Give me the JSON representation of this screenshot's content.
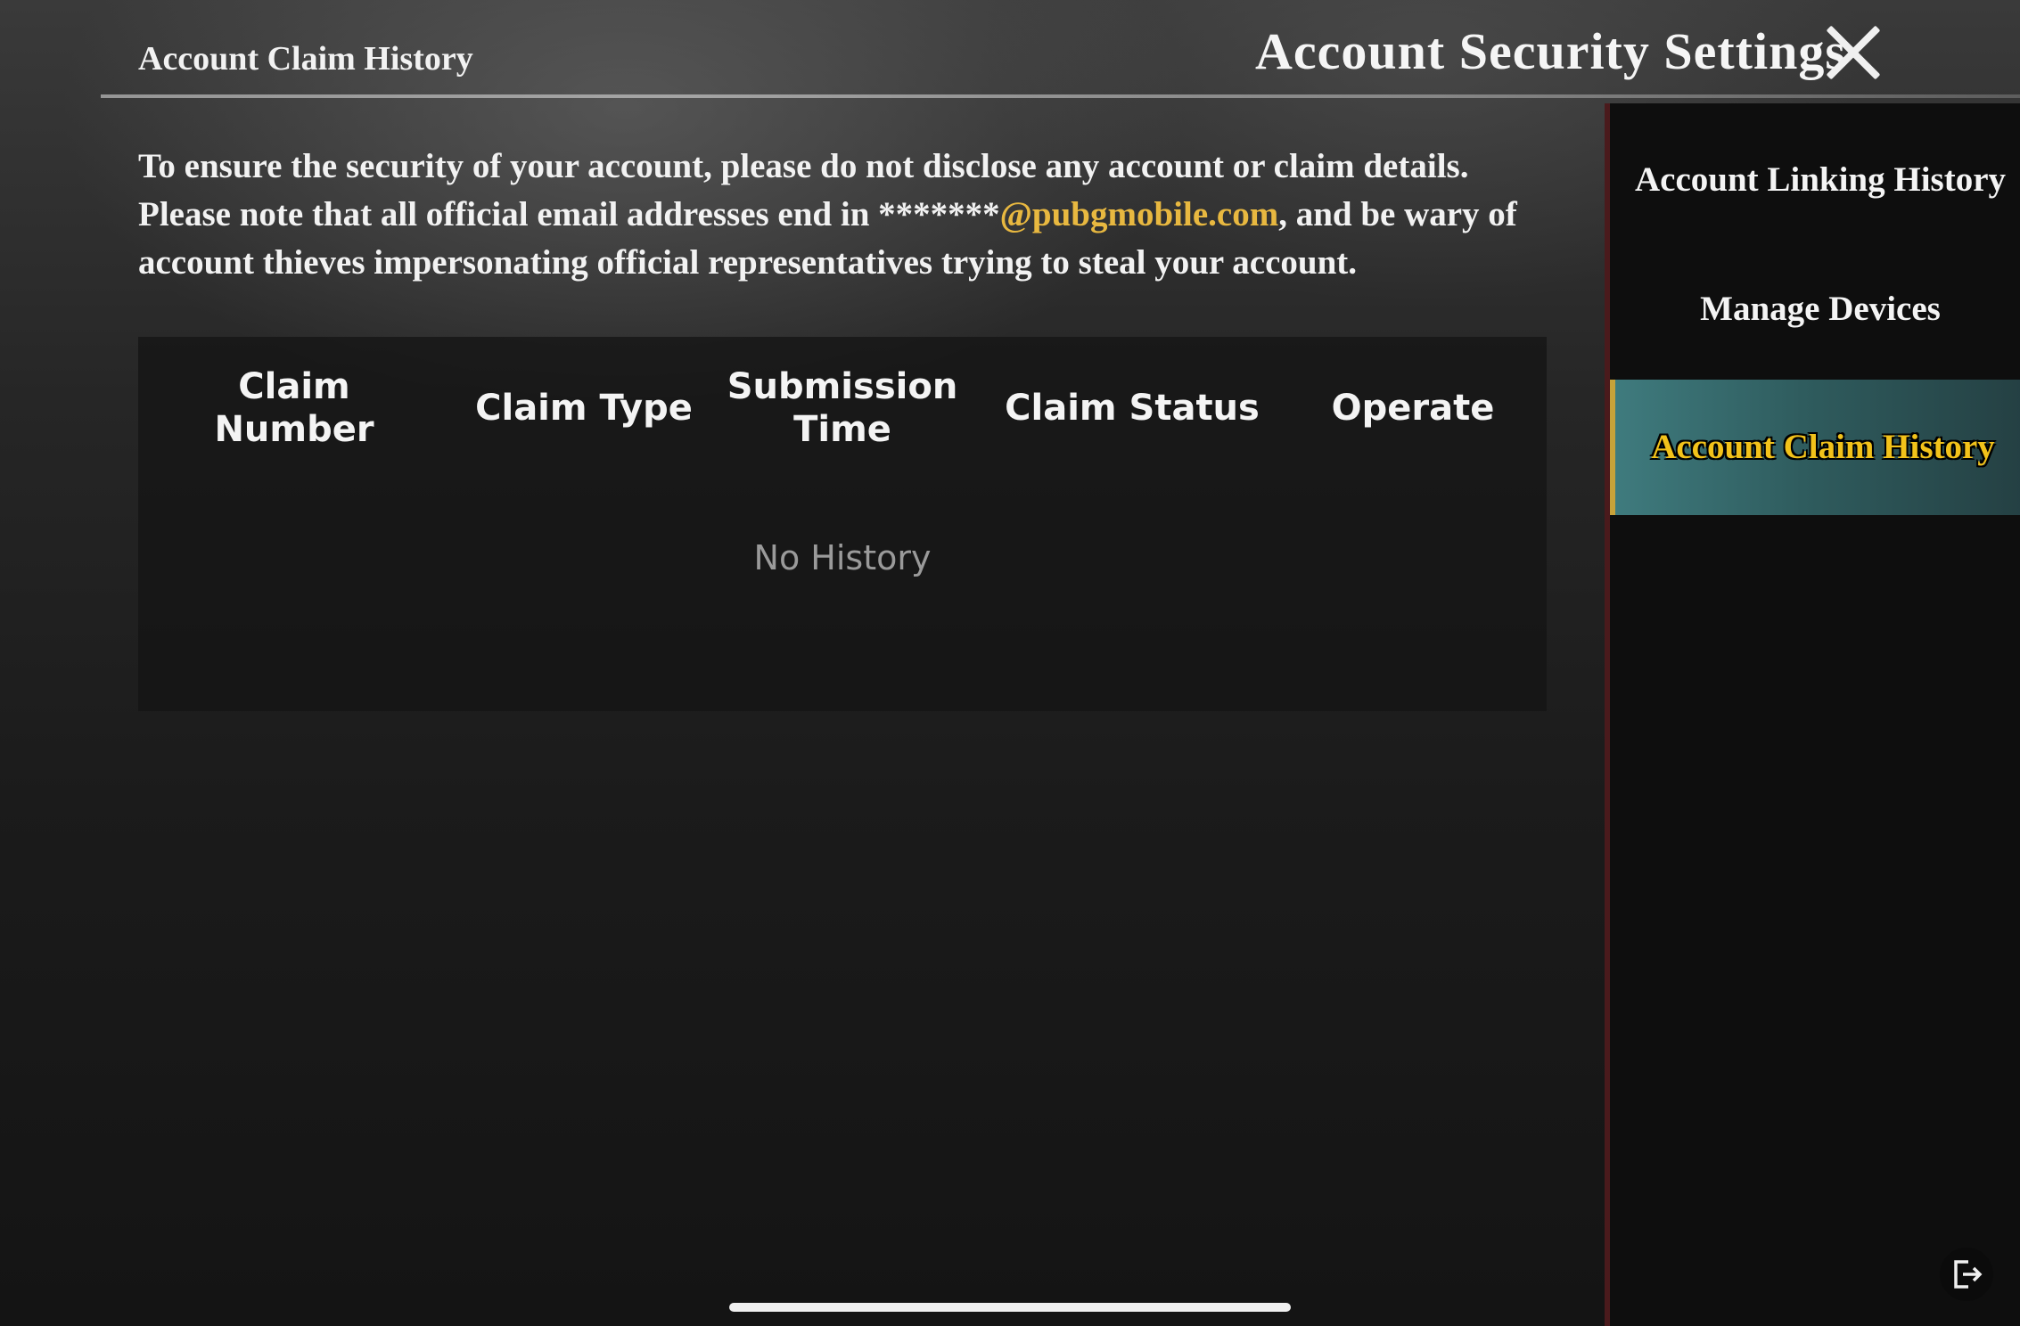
{
  "header": {
    "page_title": "Account Claim History",
    "window_title": "Account Security Settings"
  },
  "notice": {
    "text_before": "To ensure the security of your account, please do not disclose any account or claim details. Please note that all official email addresses end in *******",
    "email_domain": "@pubgmobile.com",
    "text_after": ", and be wary of account thieves impersonating official representatives trying to steal your account."
  },
  "table": {
    "columns": [
      "Claim Number",
      "Claim Type",
      "Submission Time",
      "Claim Status",
      "Operate"
    ],
    "rows": [],
    "empty_text": "No History"
  },
  "sidebar": {
    "items": [
      {
        "label": "Account Linking History",
        "active": false
      },
      {
        "label": "Manage Devices",
        "active": false
      },
      {
        "label": "Account Claim History",
        "active": true
      }
    ]
  },
  "icons": {
    "close": "close-icon",
    "logout": "logout-icon"
  },
  "colors": {
    "accent_email": "#e8b840",
    "active_tab_text": "#f2c21a",
    "active_tab_bg": "#3f7b7e"
  }
}
